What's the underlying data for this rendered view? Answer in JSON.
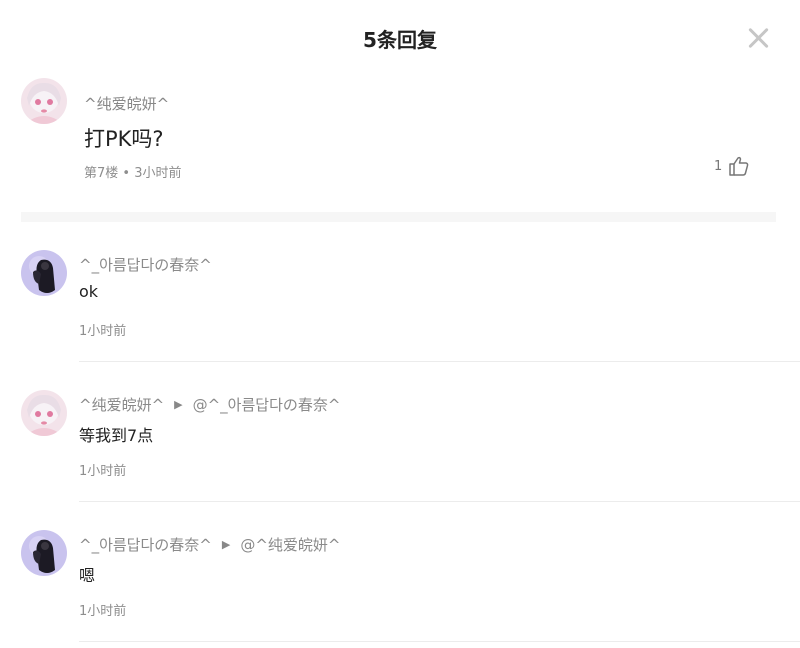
{
  "header": {
    "title": "5条回复",
    "close_icon": "close-icon"
  },
  "main_post": {
    "username": "^纯爱皖妍^",
    "content": "打PK吗?",
    "meta": "第7楼 • 3小时前",
    "like_count": "1"
  },
  "replies": [
    {
      "username": "^_아름답다の春奈^",
      "target": "",
      "content": "ok",
      "time": "1小时前"
    },
    {
      "username": "^纯爱皖妍^",
      "target": "@^_아름답다の春奈^",
      "content": "等我到7点",
      "time": "1小时前"
    },
    {
      "username": "^_아름답다の春奈^",
      "target": "@^纯爱皖妍^",
      "content": "嗯",
      "time": "1小时前"
    }
  ],
  "colors": {
    "accent_gray": "#888888",
    "divider": "#ececec",
    "band": "#f6f6f6"
  }
}
